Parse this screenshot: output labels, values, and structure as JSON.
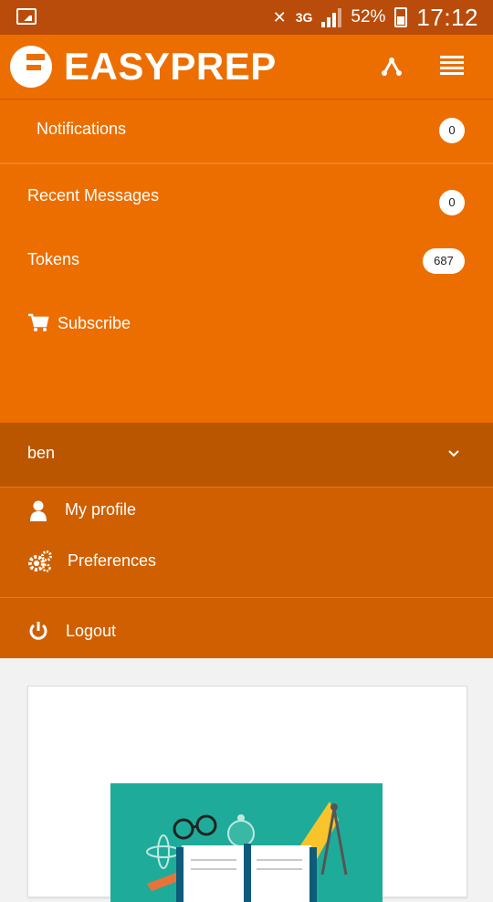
{
  "status_bar": {
    "network": "3G",
    "battery": "52%",
    "time": "17:12"
  },
  "header": {
    "brand": "EASYPREP",
    "share_icon": "share-icon",
    "menu_icon": "list-icon"
  },
  "menu": {
    "notifications": {
      "label": "Notifications",
      "count": "0"
    },
    "recent_messages": {
      "label": "Recent Messages",
      "count": "0"
    },
    "tokens": {
      "label": "Tokens",
      "count": "687"
    },
    "subscribe": {
      "label": "Subscribe",
      "icon": "cart-icon"
    }
  },
  "user": {
    "name": "ben",
    "items": [
      {
        "label": "My profile",
        "icon": "user-icon"
      },
      {
        "label": "Preferences",
        "icon": "gears-icon"
      },
      {
        "label": "Logout",
        "icon": "power-icon"
      }
    ]
  },
  "colors": {
    "primary": "#ec6e00",
    "status_bar": "#b94c0a",
    "user_bar": "#bb5600",
    "user_menu": "#cf5f00"
  }
}
